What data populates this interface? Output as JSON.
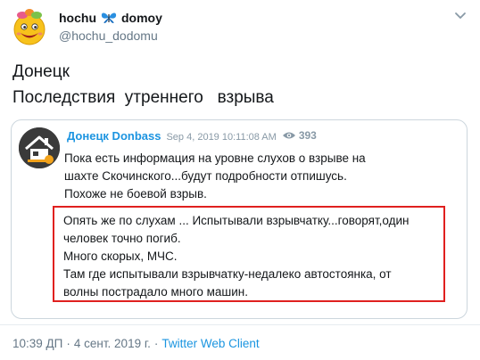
{
  "author": {
    "display_name": "hochu",
    "display_name_suffix": "domoy",
    "emoji_icon": "butterfly-emoji-icon",
    "handle": "@hochu_dodomu"
  },
  "tweet": {
    "lines": [
      "Донецк",
      "Последствия  утреннего   взрыва"
    ]
  },
  "quoted": {
    "name": "Донецк Donbass",
    "date": "Sep 4, 2019 10:11:08 AM",
    "views": "393",
    "body_lines": [
      "Пока есть информация на уровне слухов о взрыве на",
      "шахте Скочинского...будут подробности отпишусь.",
      "Похоже не боевой взрыв."
    ],
    "highlighted_lines": [
      "Опять же по слухам ... Испытывали взрывчатку...говорят,один",
      "человек точно погиб.",
      "Много скорых, МЧС.",
      "Там где испытывали взрывчатку-недалеко  автостоянка, от",
      "волны пострадало много машин."
    ]
  },
  "meta": {
    "time": "10:39 ДП",
    "date": "4 сент. 2019 г.",
    "separator": "·",
    "client": "Twitter Web Client"
  },
  "colors": {
    "link_blue": "#1b95e0",
    "highlight_red": "#e0201f",
    "muted": "#657786"
  }
}
